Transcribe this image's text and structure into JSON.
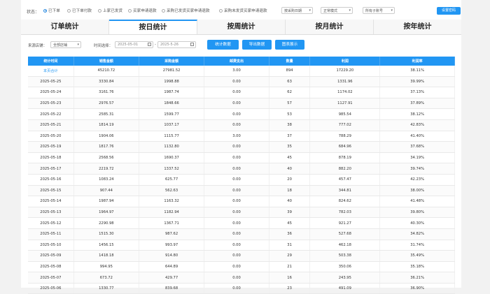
{
  "filter": {
    "status_label": "状态：",
    "radios": [
      {
        "label": "已下单",
        "selected": true
      },
      {
        "label": "已下单付款",
        "selected": false
      },
      {
        "label": "上家已发货",
        "selected": false
      },
      {
        "label": "买家申请退款",
        "selected": false
      },
      {
        "label": "采购已发货买家申请退款",
        "selected": false
      },
      {
        "label": "采购未发货买家申请退款",
        "selected": false
      }
    ],
    "select_purchase_date": "按采购日期",
    "select_mode": "正常模式",
    "select_account": "所有子账号",
    "settings_button": "设置密码"
  },
  "tabs": [
    {
      "label": "订单统计",
      "active": false
    },
    {
      "label": "按日统计",
      "active": true
    },
    {
      "label": "按周统计",
      "active": false
    },
    {
      "label": "按月统计",
      "active": false
    },
    {
      "label": "按年统计",
      "active": false
    }
  ],
  "toolbar": {
    "source_label": "来源店铺：",
    "source_value": "全部店铺",
    "time_label": "时间选择：",
    "date_start": "2025-05-01",
    "date_sep": "-",
    "date_end": "2025-5-26",
    "btn_stats": "统计数据",
    "btn_export": "导出数据",
    "btn_chart": "图表展示"
  },
  "table": {
    "headers": [
      "统计时间",
      "销售金额",
      "采购金额",
      "邮费支出",
      "数量",
      "利润",
      "利润率"
    ],
    "rows": [
      [
        "本页合计",
        "45210.72",
        "27981.52",
        "3.00",
        "894",
        "17229.20",
        "38.11%"
      ],
      [
        "2025-05-25",
        "3330.84",
        "1998.88",
        "0.00",
        "63",
        "1331.96",
        "39.99%"
      ],
      [
        "2025-05-24",
        "3161.76",
        "1987.74",
        "0.00",
        "62",
        "1174.02",
        "37.13%"
      ],
      [
        "2025-05-23",
        "2976.57",
        "1848.66",
        "0.00",
        "57",
        "1127.91",
        "37.89%"
      ],
      [
        "2025-05-22",
        "2585.31",
        "1599.77",
        "0.00",
        "53",
        "985.54",
        "38.12%"
      ],
      [
        "2025-05-21",
        "1814.19",
        "1037.17",
        "0.00",
        "38",
        "777.02",
        "42.83%"
      ],
      [
        "2025-05-20",
        "1904.06",
        "1115.77",
        "3.00",
        "37",
        "788.29",
        "41.40%"
      ],
      [
        "2025-05-19",
        "1817.76",
        "1132.80",
        "0.00",
        "35",
        "684.96",
        "37.68%"
      ],
      [
        "2025-05-18",
        "2568.56",
        "1690.37",
        "0.00",
        "45",
        "878.19",
        "34.19%"
      ],
      [
        "2025-05-17",
        "2219.72",
        "1337.52",
        "0.00",
        "40",
        "882.20",
        "39.74%"
      ],
      [
        "2025-05-16",
        "1083.24",
        "625.77",
        "0.00",
        "20",
        "457.47",
        "42.23%"
      ],
      [
        "2025-05-15",
        "907.44",
        "562.63",
        "0.00",
        "18",
        "344.81",
        "38.00%"
      ],
      [
        "2025-05-14",
        "1987.94",
        "1163.32",
        "0.00",
        "40",
        "824.62",
        "41.48%"
      ],
      [
        "2025-05-13",
        "1964.97",
        "1182.94",
        "0.00",
        "39",
        "782.03",
        "39.80%"
      ],
      [
        "2025-05-12",
        "2290.98",
        "1367.71",
        "0.00",
        "45",
        "921.27",
        "40.30%"
      ],
      [
        "2025-05-11",
        "1515.30",
        "987.62",
        "0.00",
        "36",
        "527.68",
        "34.82%"
      ],
      [
        "2025-05-10",
        "1456.15",
        "993.97",
        "0.00",
        "31",
        "462.18",
        "31.74%"
      ],
      [
        "2025-05-09",
        "1418.18",
        "914.80",
        "0.00",
        "29",
        "503.38",
        "35.49%"
      ],
      [
        "2025-05-08",
        "994.95",
        "644.89",
        "0.00",
        "21",
        "350.06",
        "35.18%"
      ],
      [
        "2025-05-07",
        "673.72",
        "429.77",
        "0.00",
        "16",
        "243.95",
        "36.21%"
      ],
      [
        "2025-05-06",
        "1330.77",
        "839.68",
        "0.00",
        "23",
        "491.09",
        "36.90%"
      ]
    ]
  }
}
